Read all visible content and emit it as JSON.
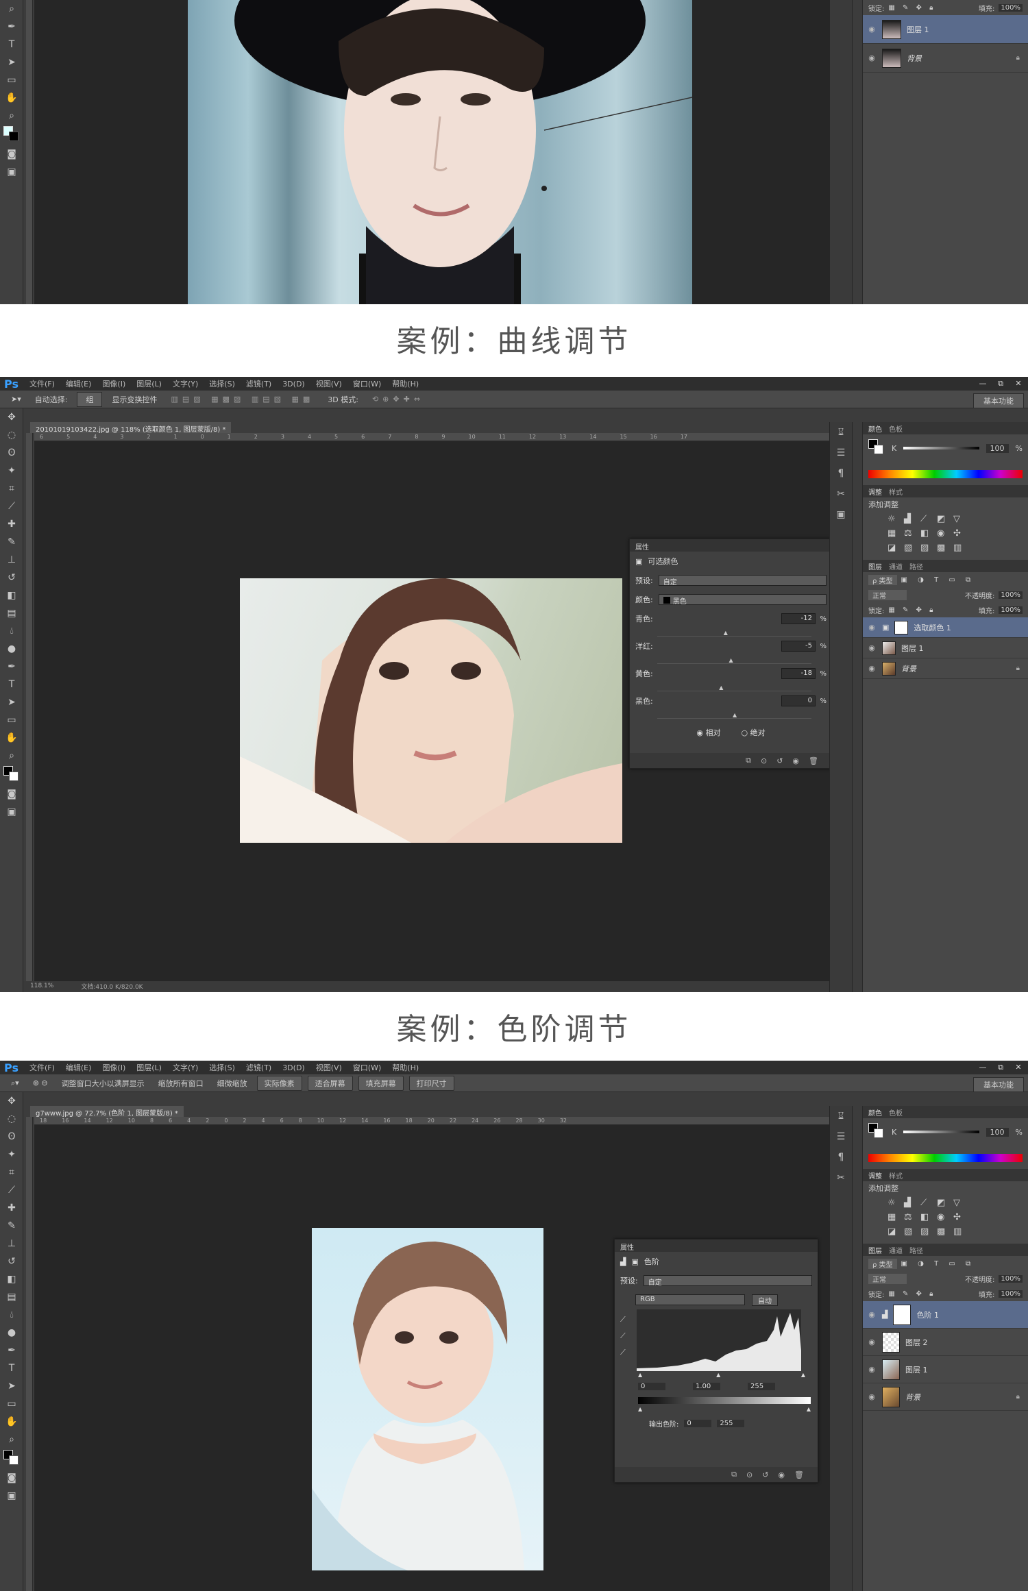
{
  "section1": {
    "panel": {
      "lock_label": "锁定:",
      "fill_label": "填充:",
      "fill_value": "100%",
      "layers": [
        {
          "name": "图层 1",
          "selected": true
        },
        {
          "name": "背景",
          "selected": false,
          "locked": true
        }
      ]
    }
  },
  "caption1": "案例：曲线调节",
  "caption2": "案例：色阶调节",
  "common": {
    "app_logo": "Ps",
    "menu": [
      "文件(F)",
      "编辑(E)",
      "图像(I)",
      "图层(L)",
      "文字(Y)",
      "选择(S)",
      "滤镜(T)",
      "3D(D)",
      "视图(V)",
      "窗口(W)",
      "帮助(H)"
    ],
    "window_buttons": [
      "—",
      "⧉",
      "✕"
    ],
    "workspace": "基本功能",
    "color_tabs": [
      "颜色",
      "色板"
    ],
    "k_label": "K",
    "k_value": "100",
    "k_unit": "%",
    "adj_tabs": [
      "调整",
      "样式"
    ],
    "adj_title": "添加调整",
    "layer_tabs": [
      "图层",
      "通道",
      "路径"
    ],
    "kind_label": "ρ 类型",
    "blend_mode": "正常",
    "opacity_label": "不透明度:",
    "opacity_value": "100%",
    "lock_label": "锁定:",
    "fill_label": "填充:",
    "fill_value": "100%",
    "properties_tab": "属性"
  },
  "section2": {
    "options": {
      "auto_select": "自动选择:",
      "group": "组",
      "show_transform": "显示变换控件",
      "mode3d": "3D 模式:"
    },
    "doc_tab": "20101019103422.jpg @ 118% (选取颜色 1, 图层蒙版/8) *",
    "ruler_ticks": [
      "6",
      "5",
      "4",
      "3",
      "2",
      "1",
      "0",
      "1",
      "2",
      "3",
      "4",
      "5",
      "6",
      "7",
      "8",
      "9",
      "10",
      "11",
      "12",
      "13",
      "14",
      "15",
      "16",
      "17"
    ],
    "status_zoom": "118.1%",
    "status_doc": "文档:410.0 K/820.0K",
    "props": {
      "title": "可选颜色",
      "preset_label": "预设:",
      "preset_value": "自定",
      "color_label": "颜色:",
      "color_value": "黑色",
      "sliders": [
        {
          "label": "青色:",
          "value": "-12",
          "level": -12
        },
        {
          "label": "洋红:",
          "value": "-5",
          "level": -5
        },
        {
          "label": "黄色:",
          "value": "-18",
          "level": -18
        },
        {
          "label": "黑色:",
          "value": "0",
          "level": 0
        }
      ],
      "unit": "%",
      "method_relative": "相对",
      "method_absolute": "绝对"
    },
    "layers": [
      {
        "name": "选取颜色 1",
        "selected": true,
        "adjustment": true
      },
      {
        "name": "图层 1",
        "selected": false
      },
      {
        "name": "背景",
        "selected": false,
        "locked": true
      }
    ]
  },
  "section3": {
    "options": {
      "resize_windows": "调整窗口大小以满屏显示",
      "zoom_all": "缩放所有窗口",
      "scrubby_zoom": "细微缩放",
      "actual_pixels": "实际像素",
      "fit_screen": "适合屏幕",
      "fill_screen": "填充屏幕",
      "print_size": "打印尺寸"
    },
    "doc_tab": "g7www.jpg @ 72.7% (色阶 1, 图层蒙版/8) *",
    "ruler_ticks": [
      "18",
      "16",
      "14",
      "12",
      "10",
      "8",
      "6",
      "4",
      "2",
      "0",
      "2",
      "4",
      "6",
      "8",
      "10",
      "12",
      "14",
      "16",
      "18",
      "20",
      "22",
      "24",
      "26",
      "28",
      "30",
      "32"
    ],
    "props": {
      "title": "色阶",
      "preset_label": "预设:",
      "preset_value": "自定",
      "channel": "RGB",
      "auto": "自动",
      "input_black": "0",
      "input_gamma": "1.00",
      "input_white": "255",
      "output_label": "输出色阶:",
      "output_black": "0",
      "output_white": "255"
    },
    "layers": [
      {
        "name": "色阶 1",
        "selected": true,
        "adjustment": true
      },
      {
        "name": "图层 2",
        "selected": false
      },
      {
        "name": "图层 1",
        "selected": false
      },
      {
        "name": "背景",
        "selected": false,
        "locked": true
      }
    ]
  }
}
